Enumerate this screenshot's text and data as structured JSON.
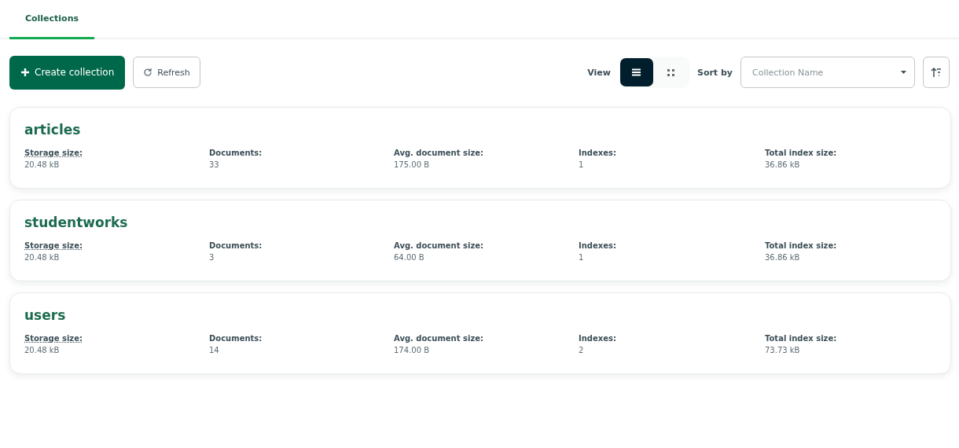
{
  "tabs": [
    {
      "label": "Collections",
      "selected": true
    }
  ],
  "toolbar": {
    "create_button": "Create collection",
    "refresh_button": "Refresh",
    "view_label": "View",
    "view_options": [
      {
        "kind": "list",
        "selected": true
      },
      {
        "kind": "grid",
        "selected": false
      }
    ],
    "sort_label": "Sort by",
    "sort_field": {
      "value": "Collection Name"
    }
  },
  "collections": [
    {
      "name": "articles",
      "stats": [
        {
          "label": "Storage size:",
          "value": "20.48 kB",
          "underlined": true
        },
        {
          "label": "Documents:",
          "value": "33",
          "underlined": false
        },
        {
          "label": "Avg. document size:",
          "value": "175.00 B",
          "underlined": false
        },
        {
          "label": "Indexes:",
          "value": "1",
          "underlined": false
        },
        {
          "label": "Total index size:",
          "value": "36.86 kB",
          "underlined": false
        }
      ]
    },
    {
      "name": "studentworks",
      "stats": [
        {
          "label": "Storage size:",
          "value": "20.48 kB",
          "underlined": true
        },
        {
          "label": "Documents:",
          "value": "3",
          "underlined": false
        },
        {
          "label": "Avg. document size:",
          "value": "64.00 B",
          "underlined": false
        },
        {
          "label": "Indexes:",
          "value": "1",
          "underlined": false
        },
        {
          "label": "Total index size:",
          "value": "36.86 kB",
          "underlined": false
        }
      ]
    },
    {
      "name": "users",
      "stats": [
        {
          "label": "Storage size:",
          "value": "20.48 kB",
          "underlined": true
        },
        {
          "label": "Documents:",
          "value": "14",
          "underlined": false
        },
        {
          "label": "Avg. document size:",
          "value": "174.00 B",
          "underlined": false
        },
        {
          "label": "Indexes:",
          "value": "2",
          "underlined": false
        },
        {
          "label": "Total index size:",
          "value": "73.73 kB",
          "underlined": false
        }
      ]
    }
  ]
}
